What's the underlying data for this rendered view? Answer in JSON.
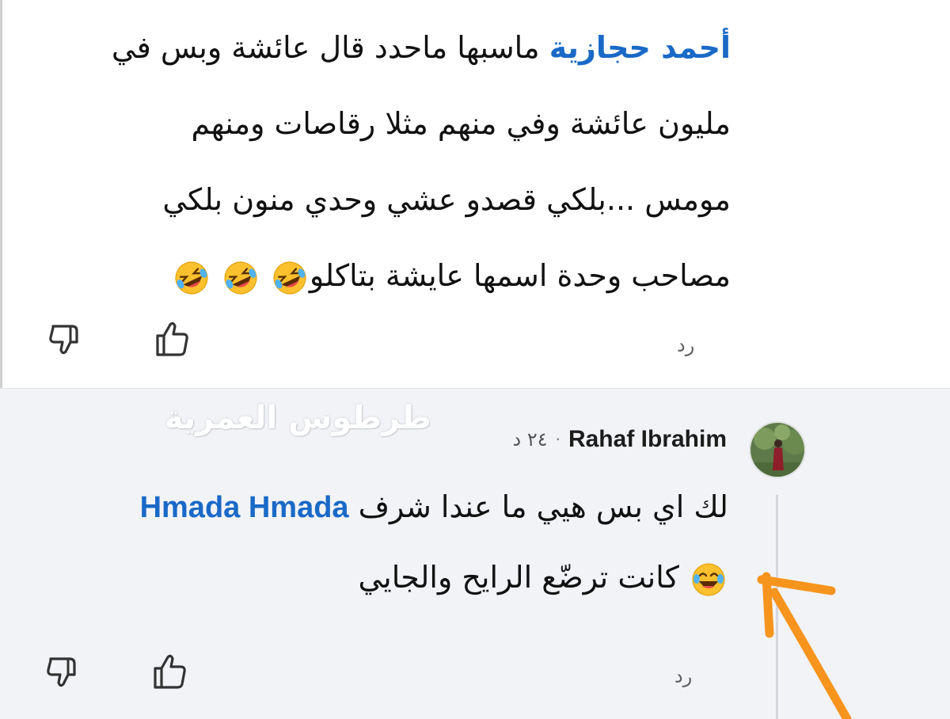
{
  "top_comment": {
    "mention": "أحمد حجازية",
    "line1_text": " ماسبها ماحدد قال عائشة وبس في",
    "line2": "مليون عائشة وفي منهم مثلا رقاصات ومنهم",
    "line3": "مومس ...بلكي قصدو عشي وحدي منون بلكي",
    "line4": "مصاحب وحدة اسمها عايشة بتاكلو",
    "emoji_icon": "rolling-laughing-emoji",
    "reply_label": "رد"
  },
  "watermark": "طرطوس العمرية",
  "reply_comment": {
    "author": "Rahaf Ibrahim",
    "time": "٢٤ د",
    "mention": "Hmada Hmada",
    "line1_text": "لك اي بس هيي ما عندا شرف ",
    "line2": "كانت ترضّع الرايح والجايي",
    "emoji_icon": "tears-of-joy-emoji",
    "reply_label": "رد"
  },
  "colors": {
    "mention": "#1a69c7",
    "arrow": "#f7941d",
    "reply_background": "#f1f3f7"
  }
}
